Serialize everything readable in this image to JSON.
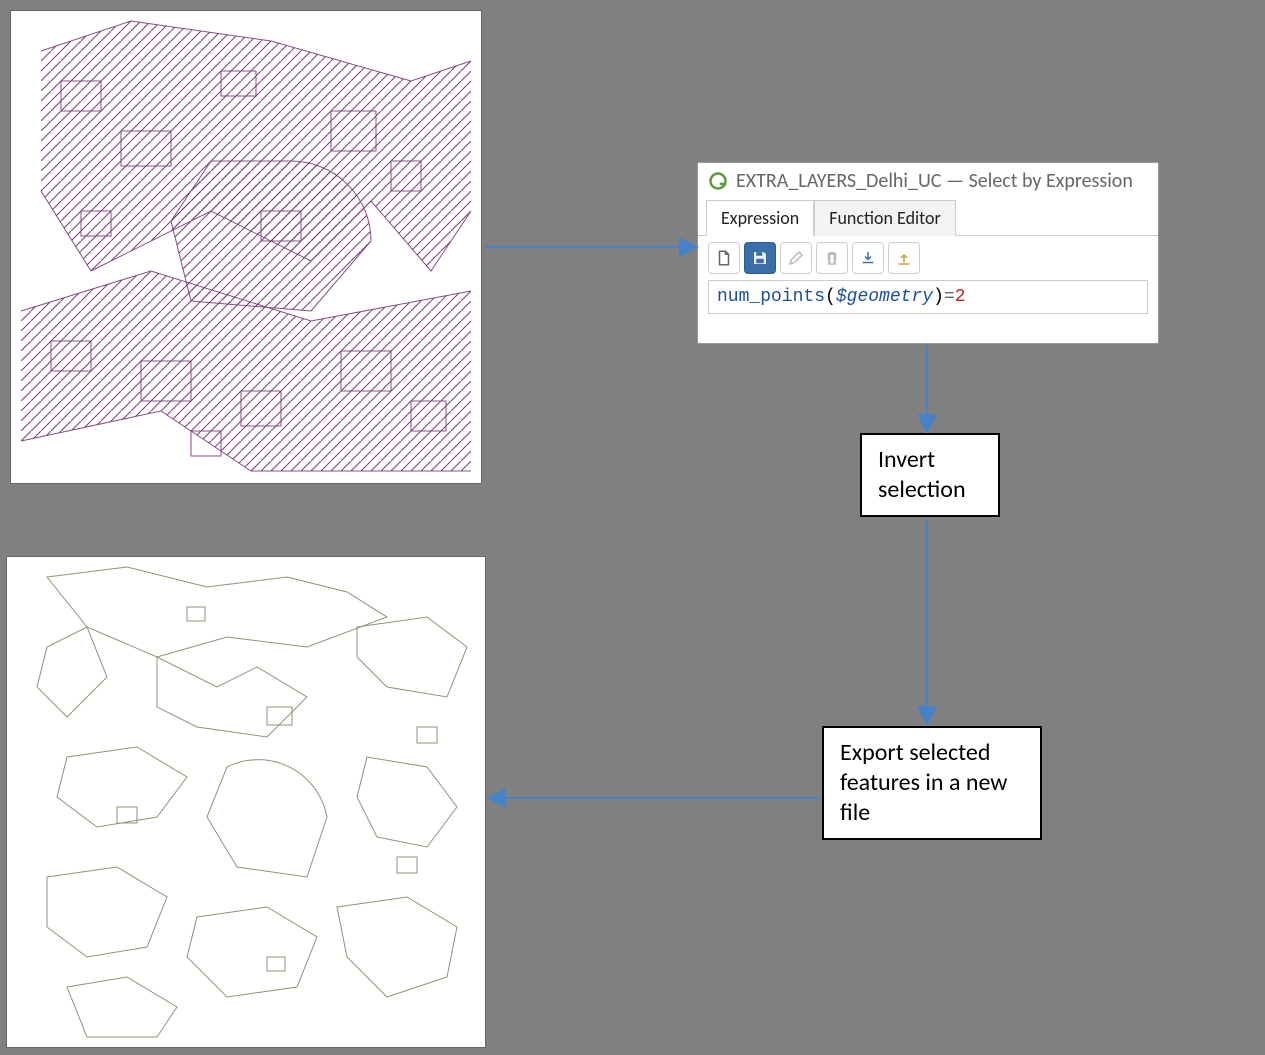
{
  "dialog": {
    "title": "EXTRA_LAYERS_Delhi_UC — Select by Expression",
    "tabs": {
      "expression": "Expression",
      "function_editor": "Function Editor"
    },
    "expression_parts": {
      "fn": "num_points",
      "open": "(",
      "var": "$geometry",
      "close": ")",
      "op": "=",
      "num": "2"
    }
  },
  "steps": {
    "invert": "Invert selection",
    "export": "Export selected features in a new file"
  },
  "arrow_color": "#4682c8",
  "map_colors": {
    "top_stroke": "#7a3a7a",
    "bottom_stroke": "#8a8565"
  }
}
